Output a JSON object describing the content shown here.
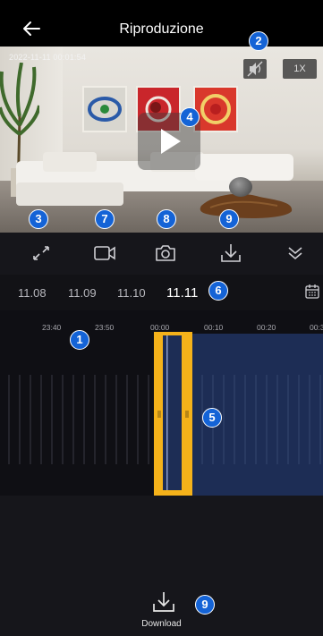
{
  "header": {
    "title": "Riproduzione",
    "back_icon": "arrow-left-icon"
  },
  "video": {
    "timestamp": "2022-11-11  00:01:54",
    "speed_label": "1X",
    "mute_icon": "speaker-muted-icon",
    "play_icon": "play-icon"
  },
  "toolbar": {
    "fullscreen_icon": "expand-icon",
    "record_icon": "video-camera-icon",
    "snapshot_icon": "camera-icon",
    "download_icon": "download-icon",
    "collapse_icon": "chevrons-down-icon"
  },
  "dates": {
    "items": [
      "11.08",
      "11.09",
      "11.10",
      "11.11"
    ],
    "selected": "11.11",
    "calendar_icon": "calendar-icon"
  },
  "timeline": {
    "labels": [
      "23:40",
      "23:50",
      "00:00",
      "00:10",
      "00:20",
      "00:3"
    ]
  },
  "download": {
    "label": "Download"
  },
  "badges": {
    "b1": "1",
    "b2": "2",
    "b3": "3",
    "b4": "4",
    "b5": "5",
    "b6": "6",
    "b7": "7",
    "b8": "8",
    "b9a": "9",
    "b9b": "9"
  },
  "colors": {
    "accent": "#f5b21a",
    "recorded": "#1d2d55",
    "badge": "#1463d6",
    "background": "#16161b"
  }
}
